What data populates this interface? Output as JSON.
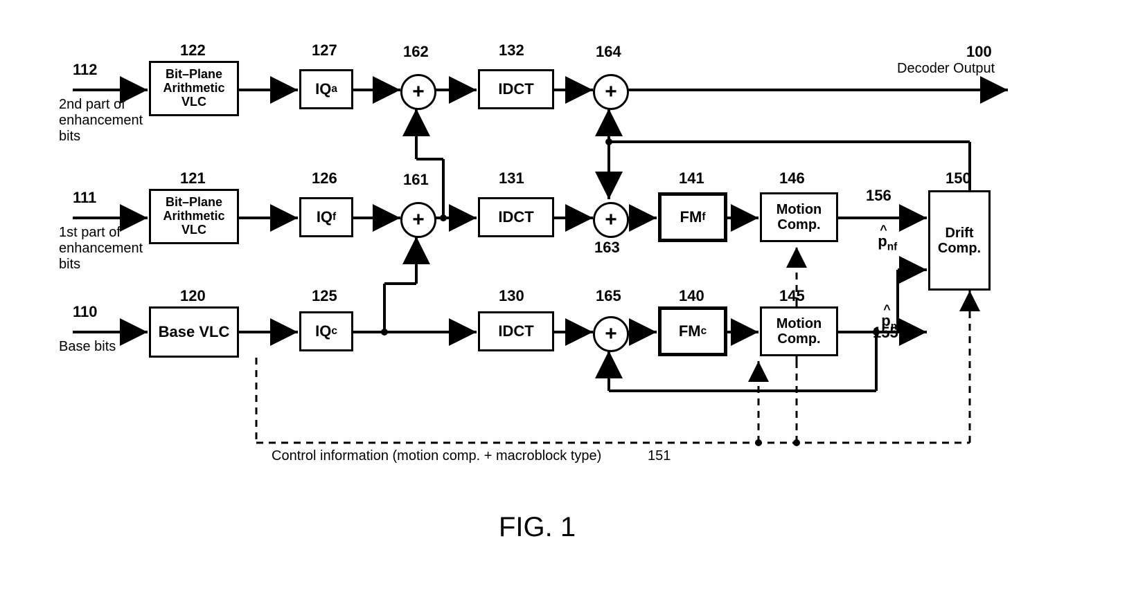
{
  "figure": "FIG. 1",
  "inputs": {
    "in112": {
      "num": "112",
      "text": "2nd part of\nenhancement\nbits"
    },
    "in111": {
      "num": "111",
      "text": "1st part of\nenhancement\nbits"
    },
    "in110": {
      "num": "110",
      "text": "Base bits"
    }
  },
  "output": {
    "num": "100",
    "text": "Decoder Output"
  },
  "blocks": {
    "b122": {
      "num": "122",
      "text": "Bit–Plane\nArithmetic\nVLC"
    },
    "b121": {
      "num": "121",
      "text": "Bit–Plane\nArithmetic\nVLC"
    },
    "b120": {
      "num": "120",
      "text": "Base\nVLC"
    },
    "b127": {
      "num": "127",
      "text": "IQ",
      "sub": "a"
    },
    "b126": {
      "num": "126",
      "text": "IQ",
      "sub": "f"
    },
    "b125": {
      "num": "125",
      "text": "IQ",
      "sub": "c"
    },
    "b132": {
      "num": "132",
      "text": "IDCT"
    },
    "b131": {
      "num": "131",
      "text": "IDCT"
    },
    "b130": {
      "num": "130",
      "text": "IDCT"
    },
    "b141": {
      "num": "141",
      "text": "FM",
      "sub": "f"
    },
    "b140": {
      "num": "140",
      "text": "FM",
      "sub": "c"
    },
    "b146": {
      "num": "146",
      "text": "Motion\nComp."
    },
    "b145": {
      "num": "145",
      "text": "Motion\nComp."
    },
    "b150": {
      "num": "150",
      "text": "Drift\nComp."
    }
  },
  "summers": {
    "s162": "162",
    "s164": "164",
    "s161": "161",
    "s163": "163",
    "s165": "165"
  },
  "signals": {
    "p_nf": {
      "num": "156",
      "sym": "p",
      "sub": "nf"
    },
    "p_nc": {
      "num": "155",
      "sym": "p",
      "sub": "nc"
    }
  },
  "control": {
    "text": "Control information (motion comp. + macroblock type)",
    "num": "151"
  }
}
